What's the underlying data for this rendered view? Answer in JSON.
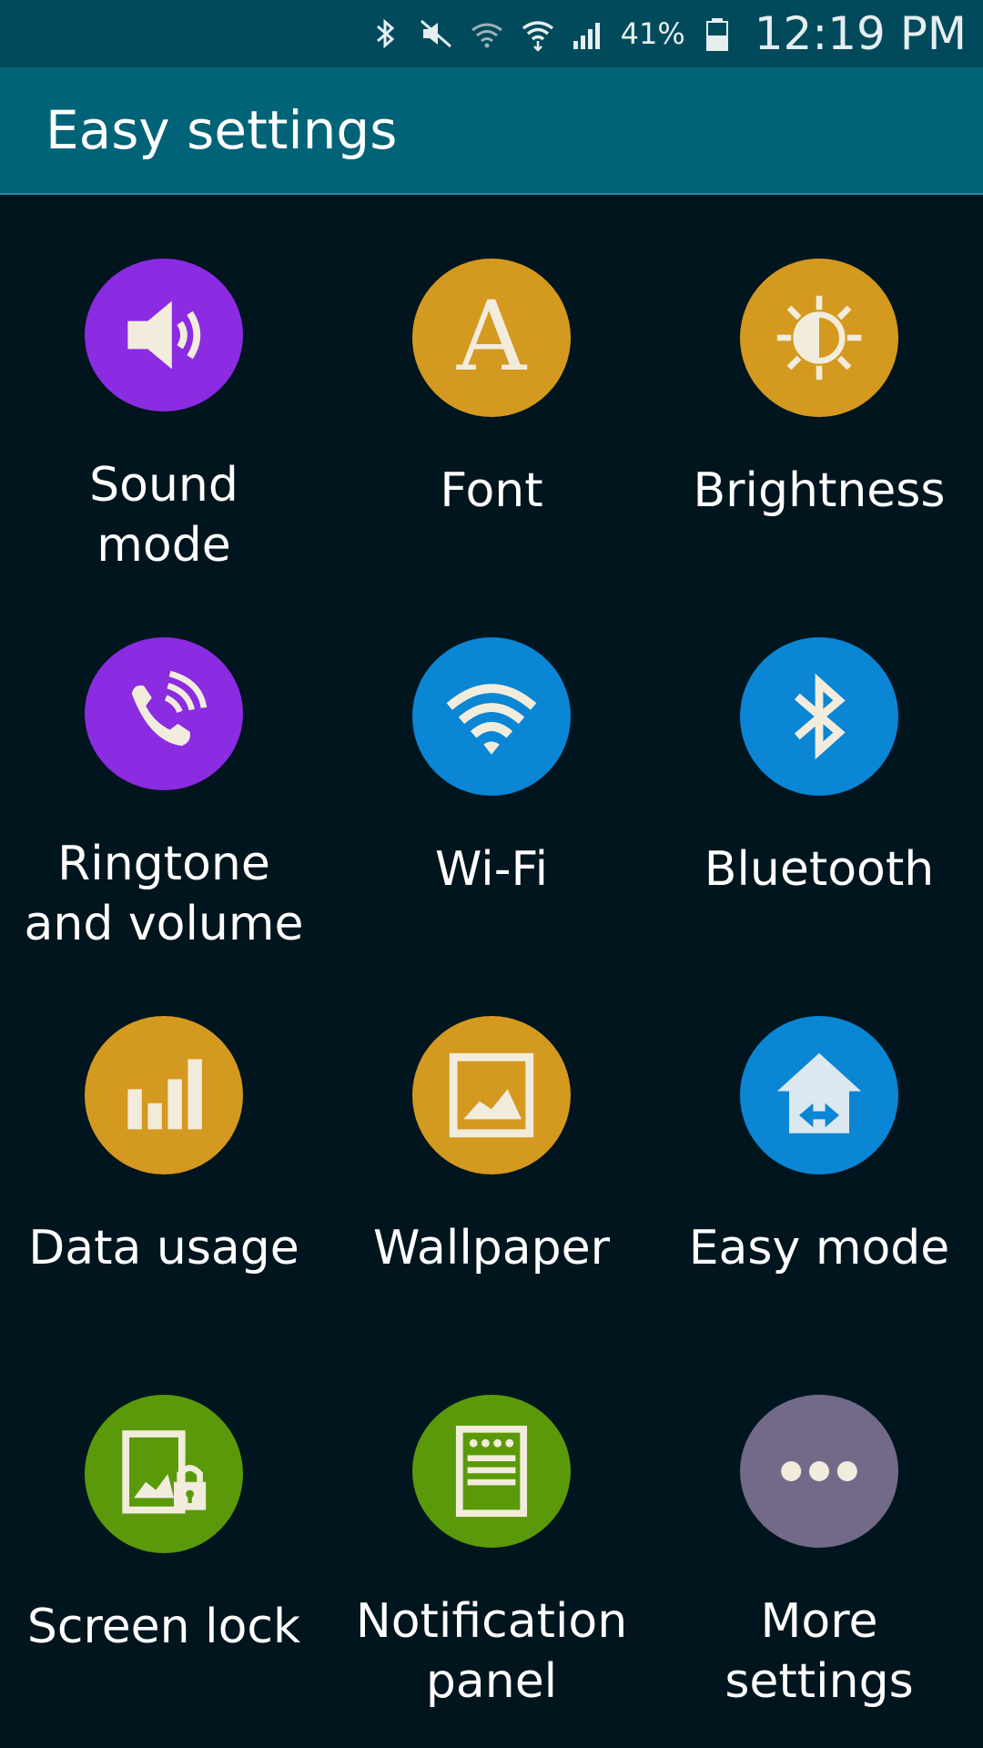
{
  "status_bar": {
    "icons": [
      "bluetooth-icon",
      "mute-icon",
      "wifi-off-icon",
      "wifi-icon",
      "signal-icon",
      "battery-icon"
    ],
    "battery_percent": "41%",
    "time": "12:19 PM"
  },
  "header": {
    "title": "Easy settings"
  },
  "colors": {
    "purple": "#8b2be2",
    "orange": "#d4991f",
    "blue": "#0a86d4",
    "green": "#5a9a0a",
    "gray": "#736a8a",
    "icon_fg": "#f2ecdc"
  },
  "grid": {
    "items": [
      {
        "label": "Sound\nmode",
        "icon": "speaker-icon",
        "color": "#8b2be2"
      },
      {
        "label": "Font",
        "icon": "font-icon",
        "color": "#d4991f"
      },
      {
        "label": "Brightness",
        "icon": "brightness-icon",
        "color": "#d4991f"
      },
      {
        "label": "Ringtone\nand volume",
        "icon": "ringtone-icon",
        "color": "#8b2be2"
      },
      {
        "label": "Wi-Fi",
        "icon": "wifi-icon",
        "color": "#0a86d4"
      },
      {
        "label": "Bluetooth",
        "icon": "bluetooth-icon",
        "color": "#0a86d4"
      },
      {
        "label": "Data usage",
        "icon": "data-usage-icon",
        "color": "#d4991f"
      },
      {
        "label": "Wallpaper",
        "icon": "wallpaper-icon",
        "color": "#d4991f"
      },
      {
        "label": "Easy mode",
        "icon": "easy-mode-icon",
        "color": "#0a86d4"
      },
      {
        "label": "Screen lock",
        "icon": "screen-lock-icon",
        "color": "#5a9a0a"
      },
      {
        "label": "Notification\npanel",
        "icon": "notification-panel-icon",
        "color": "#5a9a0a"
      },
      {
        "label": "More\nsettings",
        "icon": "more-icon",
        "color": "#736a8a"
      }
    ]
  }
}
